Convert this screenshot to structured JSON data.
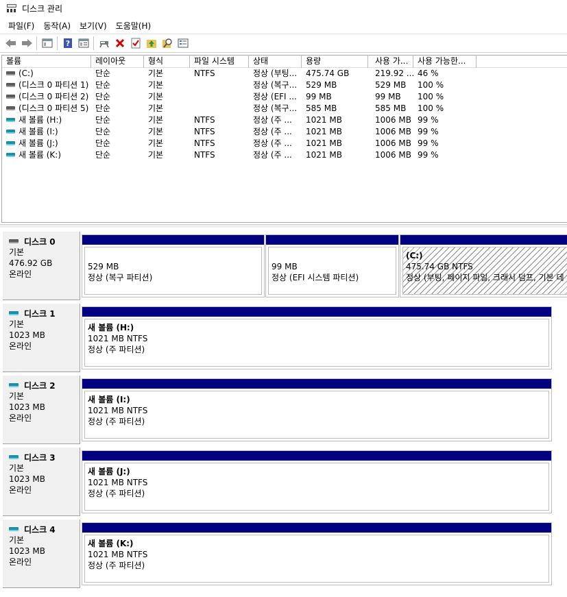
{
  "window": {
    "title": "디스크 관리"
  },
  "menu": [
    "파일(F)",
    "동작(A)",
    "보기(V)",
    "도움말(H)"
  ],
  "toolbar": [
    "back-icon",
    "forward-icon",
    "console-icon",
    "help-icon",
    "properties-icon",
    "connect-icon",
    "delete-icon",
    "check-icon",
    "folder-up-icon",
    "search-icon",
    "list-icon"
  ],
  "volume_list": {
    "columns": [
      "볼륨",
      "레이아웃",
      "형식",
      "파일 시스템",
      "상태",
      "용량",
      "사용 가...",
      "사용 가능한..."
    ],
    "rows": [
      {
        "icon": "gray",
        "volume": "(C:)",
        "layout": "단순",
        "type": "기본",
        "fs": "NTFS",
        "status": "정상 (부팅...",
        "capacity": "475.74 GB",
        "free": "219.92 ...",
        "pct": "46 %"
      },
      {
        "icon": "gray",
        "volume": "(디스크 0 파티션 1)",
        "layout": "단순",
        "type": "기본",
        "fs": "",
        "status": "정상 (복구...",
        "capacity": "529 MB",
        "free": "529 MB",
        "pct": "100 %"
      },
      {
        "icon": "gray",
        "volume": "(디스크 0 파티션 2)",
        "layout": "단순",
        "type": "기본",
        "fs": "",
        "status": "정상 (EFI ...",
        "capacity": "99 MB",
        "free": "99 MB",
        "pct": "100 %"
      },
      {
        "icon": "gray",
        "volume": "(디스크 0 파티션 5)",
        "layout": "단순",
        "type": "기본",
        "fs": "",
        "status": "정상 (복구...",
        "capacity": "585 MB",
        "free": "585 MB",
        "pct": "100 %"
      },
      {
        "icon": "cyan",
        "volume": "새 볼륨 (H:)",
        "layout": "단순",
        "type": "기본",
        "fs": "NTFS",
        "status": "정상 (주 ...",
        "capacity": "1021 MB",
        "free": "1006 MB",
        "pct": "99 %"
      },
      {
        "icon": "cyan",
        "volume": "새 볼륨 (I:)",
        "layout": "단순",
        "type": "기본",
        "fs": "NTFS",
        "status": "정상 (주 ...",
        "capacity": "1021 MB",
        "free": "1006 MB",
        "pct": "99 %"
      },
      {
        "icon": "cyan",
        "volume": "새 볼륨 (J:)",
        "layout": "단순",
        "type": "기본",
        "fs": "NTFS",
        "status": "정상 (주 ...",
        "capacity": "1021 MB",
        "free": "1006 MB",
        "pct": "99 %"
      },
      {
        "icon": "cyan",
        "volume": "새 볼륨 (K:)",
        "layout": "단순",
        "type": "기본",
        "fs": "NTFS",
        "status": "정상 (주 ...",
        "capacity": "1021 MB",
        "free": "1006 MB",
        "pct": "99 %"
      }
    ]
  },
  "disks": [
    {
      "icon": "gray",
      "name": "디스크 0",
      "type": "기본",
      "size": "476.92 GB",
      "status": "온라인",
      "partitions": [
        {
          "name": "",
          "size": "529 MB",
          "status": "정상 (복구 파티션)",
          "hatched": false
        },
        {
          "name": "",
          "size": "99 MB",
          "status": "정상 (EFI 시스템 파티션)",
          "hatched": false
        },
        {
          "name": "(C:)",
          "size": "475.74 GB NTFS",
          "status": "정상 (부팅, 페이지 파일, 크래시 덤프, 기본 데",
          "hatched": true
        }
      ]
    },
    {
      "icon": "cyan",
      "name": "디스크 1",
      "type": "기본",
      "size": "1023 MB",
      "status": "온라인",
      "partitions": [
        {
          "name": "새 볼륨  (H:)",
          "size": "1021 MB NTFS",
          "status": "정상 (주 파티션)",
          "hatched": false
        }
      ]
    },
    {
      "icon": "cyan",
      "name": "디스크 2",
      "type": "기본",
      "size": "1023 MB",
      "status": "온라인",
      "partitions": [
        {
          "name": "새 볼륨  (I:)",
          "size": "1021 MB NTFS",
          "status": "정상 (주 파티션)",
          "hatched": false
        }
      ]
    },
    {
      "icon": "cyan",
      "name": "디스크 3",
      "type": "기본",
      "size": "1023 MB",
      "status": "온라인",
      "partitions": [
        {
          "name": "새 볼륨  (J:)",
          "size": "1021 MB NTFS",
          "status": "정상 (주 파티션)",
          "hatched": false
        }
      ]
    },
    {
      "icon": "cyan",
      "name": "디스크 4",
      "type": "기본",
      "size": "1023 MB",
      "status": "온라인",
      "partitions": [
        {
          "name": "새 볼륨  (K:)",
          "size": "1021 MB NTFS",
          "status": "정상 (주 파티션)",
          "hatched": false
        }
      ]
    }
  ]
}
